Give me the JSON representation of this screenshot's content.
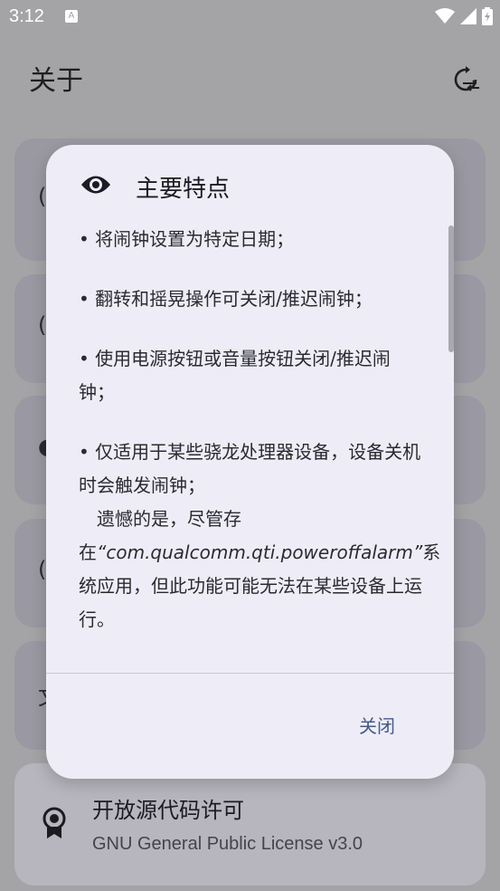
{
  "status_bar": {
    "time": "3:12",
    "notification": "A"
  },
  "app_bar": {
    "title": "关于"
  },
  "background": {
    "cards": [
      {
        "glyph": "("
      },
      {
        "glyph": "("
      },
      {
        "glyph": "◖"
      },
      {
        "glyph": "("
      },
      {
        "glyph": "文"
      }
    ],
    "license_card": {
      "title": "开放源代码许可",
      "subtitle": "GNU General Public License v3.0"
    }
  },
  "dialog": {
    "icon": "eye-icon",
    "title": "主要特点",
    "features": [
      "• 将闹钟设置为特定日期；",
      "• 翻转和摇晃操作可关闭/推迟闹钟；",
      "• 使用电源按钮或音量按钮关闭/推迟闹钟；"
    ],
    "snapdragon_note": {
      "line1": "• 仅适用于某些骁龙处理器设备，设备关机时会触发闹钟；",
      "line2": "遗憾的是，尽管存在",
      "app_name": "“com.qualcomm.qti.poweroffalarm”",
      "line3": "系统应用，但此功能可能无法在某些设备上运行。"
    },
    "close_label": "关闭"
  }
}
